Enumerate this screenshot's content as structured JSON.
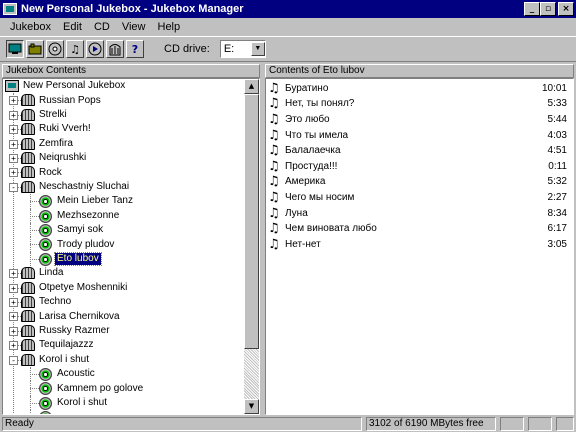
{
  "window": {
    "title": "New Personal Jukebox - Jukebox Manager",
    "buttons": {
      "minimize": "_",
      "maximize": "▫",
      "close": "×"
    }
  },
  "menu": [
    {
      "label": "Jukebox"
    },
    {
      "label": "Edit"
    },
    {
      "label": "CD"
    },
    {
      "label": "View"
    },
    {
      "label": "Help"
    }
  ],
  "toolbar": {
    "cd_drive_label": "CD drive:",
    "cd_drive_value": "E:"
  },
  "left_pane": {
    "header": "Jukebox Contents",
    "root": "New Personal Jukebox",
    "items": [
      {
        "label": "Russian Pops",
        "type": "jukebox",
        "level": 1,
        "expander": "+"
      },
      {
        "label": "Strelki",
        "type": "jukebox",
        "level": 1,
        "expander": "+"
      },
      {
        "label": "Ruki Vverh!",
        "type": "jukebox",
        "level": 1,
        "expander": "+"
      },
      {
        "label": "Zemfira",
        "type": "jukebox",
        "level": 1,
        "expander": "+"
      },
      {
        "label": "Neiqrushki",
        "type": "jukebox",
        "level": 1,
        "expander": "+"
      },
      {
        "label": "Rock",
        "type": "jukebox",
        "level": 1,
        "expander": "+"
      },
      {
        "label": "Neschastniy Sluchai",
        "type": "jukebox",
        "level": 1,
        "expander": "-"
      },
      {
        "label": "Mein Lieber Tanz",
        "type": "disc",
        "level": 2,
        "expander": ""
      },
      {
        "label": "Mezhsezonne",
        "type": "disc",
        "level": 2,
        "expander": ""
      },
      {
        "label": "Samyi sok",
        "type": "disc",
        "level": 2,
        "expander": ""
      },
      {
        "label": "Trody pludov",
        "type": "disc",
        "level": 2,
        "expander": ""
      },
      {
        "label": "Eto lubov",
        "type": "disc",
        "level": 2,
        "expander": "",
        "selected": true
      },
      {
        "label": "Linda",
        "type": "jukebox",
        "level": 1,
        "expander": "+"
      },
      {
        "label": "Otpetye Moshenniki",
        "type": "jukebox",
        "level": 1,
        "expander": "+"
      },
      {
        "label": "Techno",
        "type": "jukebox",
        "level": 1,
        "expander": "+"
      },
      {
        "label": "Larisa Chernikova",
        "type": "jukebox",
        "level": 1,
        "expander": "+"
      },
      {
        "label": "Russky Razmer",
        "type": "jukebox",
        "level": 1,
        "expander": "+"
      },
      {
        "label": "Tequilajazzz",
        "type": "jukebox",
        "level": 1,
        "expander": "+"
      },
      {
        "label": "Korol i shut",
        "type": "jukebox",
        "level": 1,
        "expander": "-"
      },
      {
        "label": "Acoustic",
        "type": "disc",
        "level": 2,
        "expander": ""
      },
      {
        "label": "Kamnem po golove",
        "type": "disc",
        "level": 2,
        "expander": ""
      },
      {
        "label": "Korol i shut",
        "type": "disc",
        "level": 2,
        "expander": ""
      },
      {
        "label": "",
        "type": "disc",
        "level": 2,
        "expander": ""
      }
    ]
  },
  "right_pane": {
    "header": "Contents of Eto lubov",
    "tracks": [
      {
        "title": "Буратино",
        "duration": "10:01"
      },
      {
        "title": "Нет, ты понял?",
        "duration": "5:33"
      },
      {
        "title": "Это любо",
        "duration": "5:44"
      },
      {
        "title": "Что ты имела",
        "duration": "4:03"
      },
      {
        "title": "Балалаечка",
        "duration": "4:51"
      },
      {
        "title": "Простуда!!!",
        "duration": "0:11"
      },
      {
        "title": "Америка",
        "duration": "5:32"
      },
      {
        "title": "Чего мы носим",
        "duration": "2:27"
      },
      {
        "title": "Луна",
        "duration": "8:34"
      },
      {
        "title": "Чем виновата любо",
        "duration": "6:17"
      },
      {
        "title": "Нет-нет",
        "duration": "3:05"
      }
    ]
  },
  "status": {
    "left": "Ready",
    "free_space": "3102 of 6190 MBytes free"
  }
}
